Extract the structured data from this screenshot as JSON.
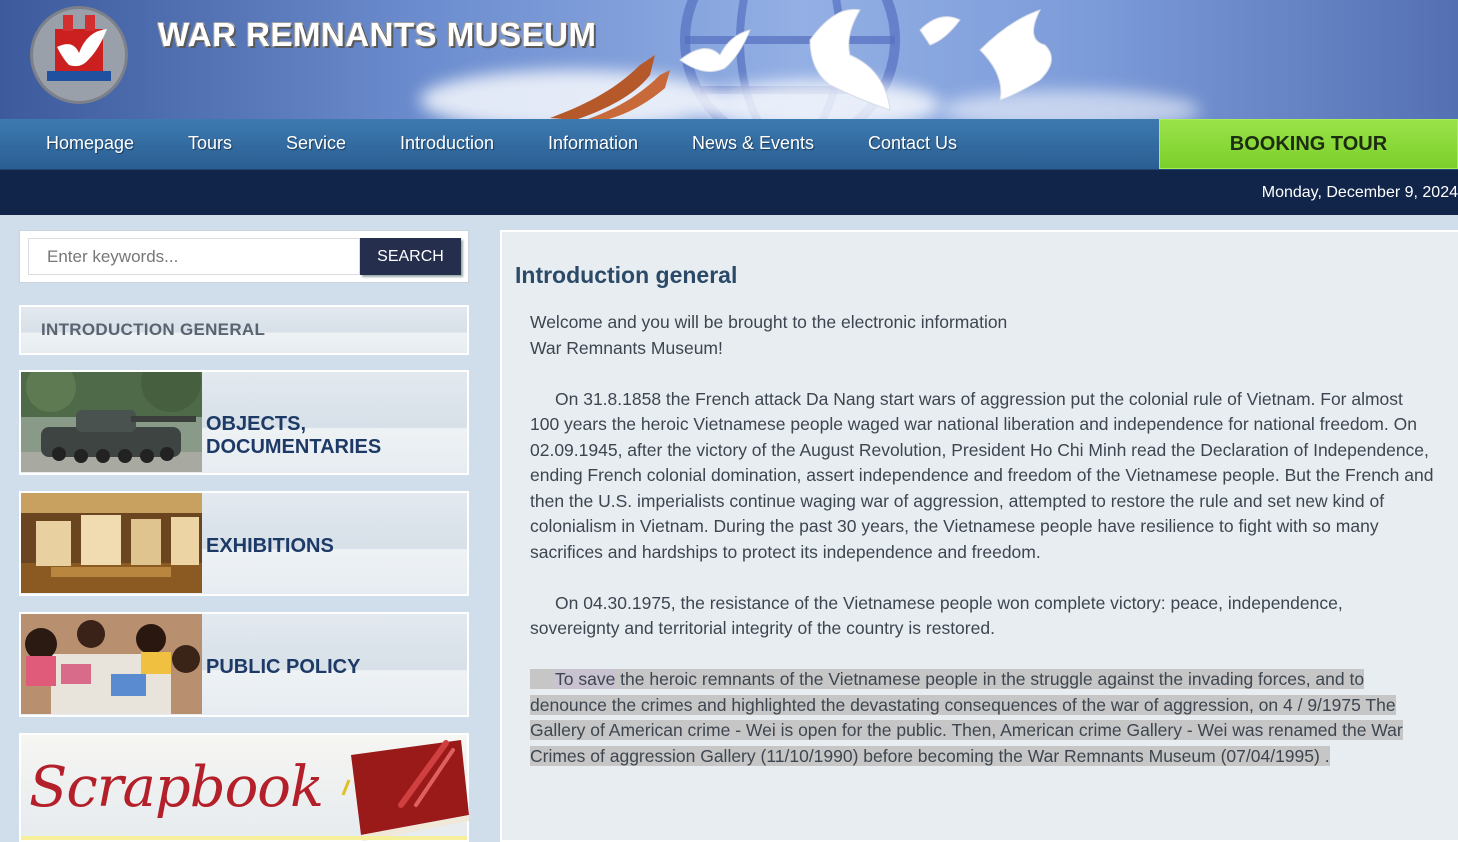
{
  "header": {
    "site_title": "WAR REMNANTS MUSEUM",
    "logo_icon": "dove-emblem-logo"
  },
  "nav": {
    "items": [
      "Homepage",
      "Tours",
      "Service",
      "Introduction",
      "Information",
      "News & Events",
      "Contact Us"
    ],
    "booking_label": "BOOKING TOUR"
  },
  "date_text": "Monday, December 9, 2024",
  "search": {
    "placeholder": "Enter keywords...",
    "value": "",
    "button_label": "SEARCH"
  },
  "sidebar": {
    "intro_heading": "INTRODUCTION GENERAL",
    "links": [
      {
        "label_line1": "OBJECTS,",
        "label_line2": "DOCUMENTARIES",
        "thumb": "tank-photo"
      },
      {
        "label": "EXHIBITIONS",
        "thumb": "exhibition-hall-photo"
      },
      {
        "label": "PUBLIC POLICY",
        "thumb": "children-drawing-photo"
      }
    ],
    "scrapbook_label": "Scrapbook"
  },
  "main": {
    "title": "Introduction general",
    "welcome_line1": "Welcome and you will be brought to the electronic information",
    "welcome_line2": "War Remnants Museum!",
    "para1": "On 31.8.1858 the French attack Da Nang start wars of aggression put the colonial rule of Vietnam. For almost 100 years the heroic Vietnamese people waged war national liberation and independence for national freedom. On 02.09.1945, after the victory of the August Revolution, President Ho Chi Minh read the Declaration of Independence, ending French colonial domination, assert independence and freedom of the Vietnamese people. But the French and then the U.S. imperialists continue waging war of aggression, attempted to restore the rule and set new kind of colonialism in Vietnam. During the past 30 years, the Vietnamese people have resilience to fight with so many sacrifices and hardships to protect its independence and freedom.",
    "para2": "On 04.30.1975, the resistance of the Vietnamese people won complete victory: peace, independence, sovereignty and territorial integrity of the country is restored.",
    "para3_selected": "To save",
    "para3_rest": " the heroic remnants of the Vietnamese people in the struggle against the invading forces, and to denounce the crimes and highlighted the devastating consequences of the war of aggression, on 4 / 9/1975 The Gallery of American crime - Wei is open for the public. Then, American crime Gallery - Wei was renamed the War Crimes of aggression Gallery (11/10/1990) before becoming the War Remnants Museum (07/04/1995) ."
  },
  "colors": {
    "nav_bg": "#2a5e92",
    "booking_bg": "#7bcf2a",
    "date_bar_bg": "#11244a",
    "label_text": "#1d3a66",
    "title_text": "#2a4a68"
  }
}
